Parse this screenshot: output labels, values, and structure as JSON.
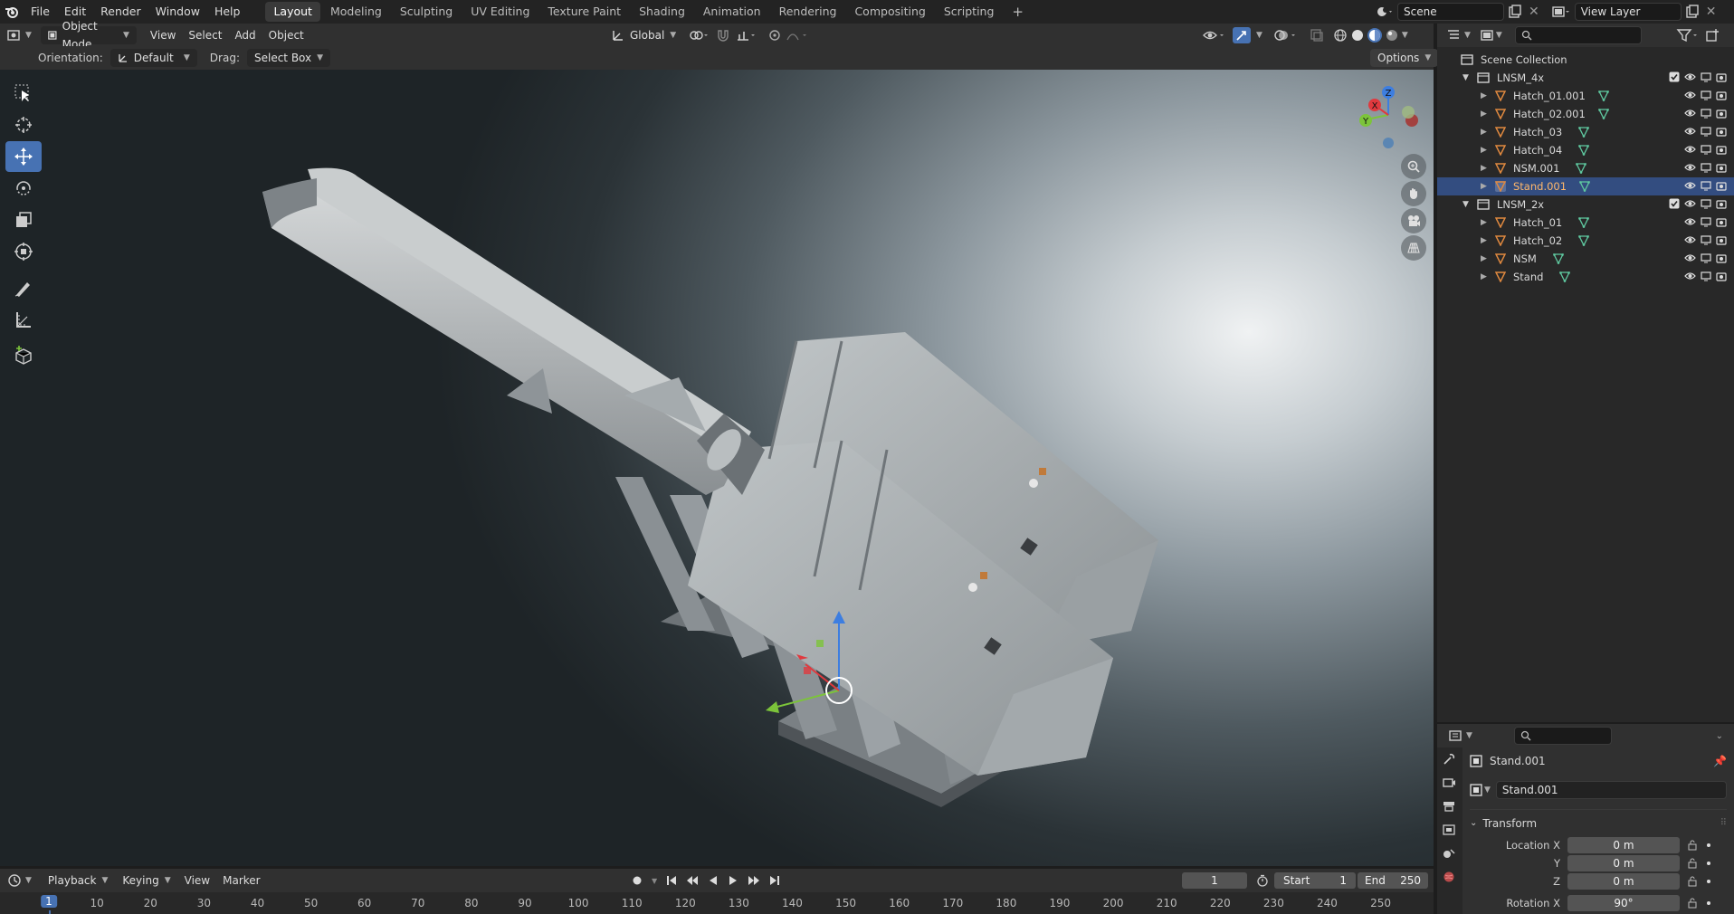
{
  "topbar": {
    "menus": [
      "File",
      "Edit",
      "Render",
      "Window",
      "Help"
    ],
    "workspaces": [
      "Layout",
      "Modeling",
      "Sculpting",
      "UV Editing",
      "Texture Paint",
      "Shading",
      "Animation",
      "Rendering",
      "Compositing",
      "Scripting"
    ],
    "active_workspace": "Layout",
    "add_tab": "+",
    "scene_name": "Scene",
    "view_layer_name": "View Layer"
  },
  "viewport_header": {
    "mode": "Object Mode",
    "menus": [
      "View",
      "Select",
      "Add",
      "Object"
    ],
    "transform_orientation": "Global"
  },
  "tool_options": {
    "orientation_label": "Orientation:",
    "orientation_value": "Default",
    "drag_label": "Drag:",
    "drag_value": "Select Box",
    "options_label": "Options"
  },
  "gizmo": {
    "x": "X",
    "y": "Y",
    "z": "Z"
  },
  "outliner": {
    "root": "Scene Collection",
    "collections": [
      {
        "name": "LNSM_4x",
        "items": [
          "Hatch_01.001",
          "Hatch_02.001",
          "Hatch_03",
          "Hatch_04",
          "NSM.001",
          "Stand.001"
        ],
        "selected": "Stand.001"
      },
      {
        "name": "LNSM_2x",
        "items": [
          "Hatch_01",
          "Hatch_02",
          "NSM",
          "Stand"
        ]
      }
    ]
  },
  "properties": {
    "object_name": "Stand.001",
    "data_name": "Stand.001",
    "panel": "Transform",
    "location": [
      {
        "label": "Location X",
        "value": "0 m"
      },
      {
        "label": "Y",
        "value": "0 m"
      },
      {
        "label": "Z",
        "value": "0 m"
      }
    ],
    "rotation_label": "Rotation X",
    "rotation_value": "90°"
  },
  "timeline": {
    "menus": [
      "Playback",
      "Keying",
      "View",
      "Marker"
    ],
    "current_frame": "1",
    "start_label": "Start",
    "start_value": "1",
    "end_label": "End",
    "end_value": "250",
    "ruler_ticks": [
      "1",
      "10",
      "20",
      "30",
      "40",
      "50",
      "60",
      "70",
      "80",
      "90",
      "100",
      "110",
      "120",
      "130",
      "140",
      "150",
      "160",
      "170",
      "180",
      "190",
      "200",
      "210",
      "220",
      "230",
      "240",
      "250"
    ]
  },
  "colors": {
    "accent": "#4772b3",
    "selection": "#334d80",
    "mesh_icon": "#5fc9a0",
    "object_icon": "#e0893f"
  }
}
